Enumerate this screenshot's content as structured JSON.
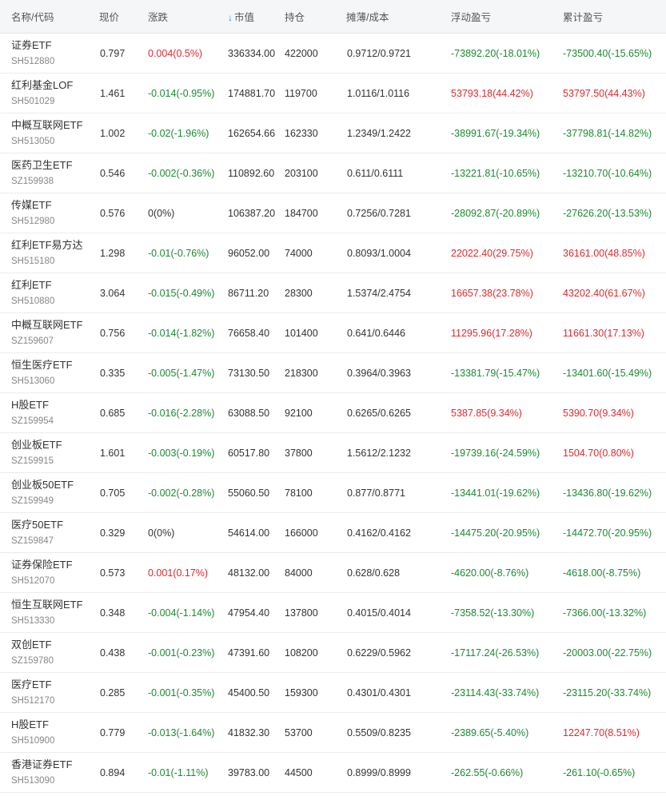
{
  "colors": {
    "up": "#e0292e",
    "down": "#1b8a32",
    "flat": "#333333",
    "sort_icon": "#1e88e5",
    "header_bg": "#f5f6f8"
  },
  "header": {
    "name": "名称/代码",
    "price": "现价",
    "change": "涨跌",
    "sort_icon": "↓",
    "market_value": "市值",
    "position": "持仓",
    "cost": "摊薄/成本",
    "floating_pnl": "浮动盈亏",
    "total_pnl": "累计盈亏"
  },
  "rows": [
    {
      "name": "证券ETF",
      "code": "SH512880",
      "price": "0.797",
      "change": "0.004(0.5%)",
      "change_dir": "up",
      "market_value": "336334.00",
      "position": "422000",
      "cost": "0.9712/0.9721",
      "floating_pnl": "-73892.20(-18.01%)",
      "floating_dir": "down",
      "total_pnl": "-73500.40(-15.65%)",
      "total_dir": "down"
    },
    {
      "name": "红利基金LOF",
      "code": "SH501029",
      "price": "1.461",
      "change": "-0.014(-0.95%)",
      "change_dir": "down",
      "market_value": "174881.70",
      "position": "119700",
      "cost": "1.0116/1.0116",
      "floating_pnl": "53793.18(44.42%)",
      "floating_dir": "up",
      "total_pnl": "53797.50(44.43%)",
      "total_dir": "up"
    },
    {
      "name": "中概互联网ETF",
      "code": "SH513050",
      "price": "1.002",
      "change": "-0.02(-1.96%)",
      "change_dir": "down",
      "market_value": "162654.66",
      "position": "162330",
      "cost": "1.2349/1.2422",
      "floating_pnl": "-38991.67(-19.34%)",
      "floating_dir": "down",
      "total_pnl": "-37798.81(-14.82%)",
      "total_dir": "down"
    },
    {
      "name": "医药卫生ETF",
      "code": "SZ159938",
      "price": "0.546",
      "change": "-0.002(-0.36%)",
      "change_dir": "down",
      "market_value": "110892.60",
      "position": "203100",
      "cost": "0.611/0.6111",
      "floating_pnl": "-13221.81(-10.65%)",
      "floating_dir": "down",
      "total_pnl": "-13210.70(-10.64%)",
      "total_dir": "down"
    },
    {
      "name": "传媒ETF",
      "code": "SH512980",
      "price": "0.576",
      "change": "0(0%)",
      "change_dir": "flat",
      "market_value": "106387.20",
      "position": "184700",
      "cost": "0.7256/0.7281",
      "floating_pnl": "-28092.87(-20.89%)",
      "floating_dir": "down",
      "total_pnl": "-27626.20(-13.53%)",
      "total_dir": "down"
    },
    {
      "name": "红利ETF易方达",
      "code": "SH515180",
      "price": "1.298",
      "change": "-0.01(-0.76%)",
      "change_dir": "down",
      "market_value": "96052.00",
      "position": "74000",
      "cost": "0.8093/1.0004",
      "floating_pnl": "22022.40(29.75%)",
      "floating_dir": "up",
      "total_pnl": "36161.00(48.85%)",
      "total_dir": "up"
    },
    {
      "name": "红利ETF",
      "code": "SH510880",
      "price": "3.064",
      "change": "-0.015(-0.49%)",
      "change_dir": "down",
      "market_value": "86711.20",
      "position": "28300",
      "cost": "1.5374/2.4754",
      "floating_pnl": "16657.38(23.78%)",
      "floating_dir": "up",
      "total_pnl": "43202.40(61.67%)",
      "total_dir": "up"
    },
    {
      "name": "中概互联网ETF",
      "code": "SZ159607",
      "price": "0.756",
      "change": "-0.014(-1.82%)",
      "change_dir": "down",
      "market_value": "76658.40",
      "position": "101400",
      "cost": "0.641/0.6446",
      "floating_pnl": "11295.96(17.28%)",
      "floating_dir": "up",
      "total_pnl": "11661.30(17.13%)",
      "total_dir": "up"
    },
    {
      "name": "恒生医疗ETF",
      "code": "SH513060",
      "price": "0.335",
      "change": "-0.005(-1.47%)",
      "change_dir": "down",
      "market_value": "73130.50",
      "position": "218300",
      "cost": "0.3964/0.3963",
      "floating_pnl": "-13381.79(-15.47%)",
      "floating_dir": "down",
      "total_pnl": "-13401.60(-15.49%)",
      "total_dir": "down"
    },
    {
      "name": "H股ETF",
      "code": "SZ159954",
      "price": "0.685",
      "change": "-0.016(-2.28%)",
      "change_dir": "down",
      "market_value": "63088.50",
      "position": "92100",
      "cost": "0.6265/0.6265",
      "floating_pnl": "5387.85(9.34%)",
      "floating_dir": "up",
      "total_pnl": "5390.70(9.34%)",
      "total_dir": "up"
    },
    {
      "name": "创业板ETF",
      "code": "SZ159915",
      "price": "1.601",
      "change": "-0.003(-0.19%)",
      "change_dir": "down",
      "market_value": "60517.80",
      "position": "37800",
      "cost": "1.5612/2.1232",
      "floating_pnl": "-19739.16(-24.59%)",
      "floating_dir": "down",
      "total_pnl": "1504.70(0.80%)",
      "total_dir": "up"
    },
    {
      "name": "创业板50ETF",
      "code": "SZ159949",
      "price": "0.705",
      "change": "-0.002(-0.28%)",
      "change_dir": "down",
      "market_value": "55060.50",
      "position": "78100",
      "cost": "0.877/0.8771",
      "floating_pnl": "-13441.01(-19.62%)",
      "floating_dir": "down",
      "total_pnl": "-13436.80(-19.62%)",
      "total_dir": "down"
    },
    {
      "name": "医疗50ETF",
      "code": "SZ159847",
      "price": "0.329",
      "change": "0(0%)",
      "change_dir": "flat",
      "market_value": "54614.00",
      "position": "166000",
      "cost": "0.4162/0.4162",
      "floating_pnl": "-14475.20(-20.95%)",
      "floating_dir": "down",
      "total_pnl": "-14472.70(-20.95%)",
      "total_dir": "down"
    },
    {
      "name": "证券保险ETF",
      "code": "SH512070",
      "price": "0.573",
      "change": "0.001(0.17%)",
      "change_dir": "up",
      "market_value": "48132.00",
      "position": "84000",
      "cost": "0.628/0.628",
      "floating_pnl": "-4620.00(-8.76%)",
      "floating_dir": "down",
      "total_pnl": "-4618.00(-8.75%)",
      "total_dir": "down"
    },
    {
      "name": "恒生互联网ETF",
      "code": "SH513330",
      "price": "0.348",
      "change": "-0.004(-1.14%)",
      "change_dir": "down",
      "market_value": "47954.40",
      "position": "137800",
      "cost": "0.4015/0.4014",
      "floating_pnl": "-7358.52(-13.30%)",
      "floating_dir": "down",
      "total_pnl": "-7366.00(-13.32%)",
      "total_dir": "down"
    },
    {
      "name": "双创ETF",
      "code": "SZ159780",
      "price": "0.438",
      "change": "-0.001(-0.23%)",
      "change_dir": "down",
      "market_value": "47391.60",
      "position": "108200",
      "cost": "0.6229/0.5962",
      "floating_pnl": "-17117.24(-26.53%)",
      "floating_dir": "down",
      "total_pnl": "-20003.00(-22.75%)",
      "total_dir": "down"
    },
    {
      "name": "医疗ETF",
      "code": "SH512170",
      "price": "0.285",
      "change": "-0.001(-0.35%)",
      "change_dir": "down",
      "market_value": "45400.50",
      "position": "159300",
      "cost": "0.4301/0.4301",
      "floating_pnl": "-23114.43(-33.74%)",
      "floating_dir": "down",
      "total_pnl": "-23115.20(-33.74%)",
      "total_dir": "down"
    },
    {
      "name": "H股ETF",
      "code": "SH510900",
      "price": "0.779",
      "change": "-0.013(-1.64%)",
      "change_dir": "down",
      "market_value": "41832.30",
      "position": "53700",
      "cost": "0.5509/0.8235",
      "floating_pnl": "-2389.65(-5.40%)",
      "floating_dir": "down",
      "total_pnl": "12247.70(8.51%)",
      "total_dir": "up"
    },
    {
      "name": "香港证券ETF",
      "code": "SH513090",
      "price": "0.894",
      "change": "-0.01(-1.11%)",
      "change_dir": "down",
      "market_value": "39783.00",
      "position": "44500",
      "cost": "0.8999/0.8999",
      "floating_pnl": "-262.55(-0.66%)",
      "floating_dir": "down",
      "total_pnl": "-261.10(-0.65%)",
      "total_dir": "down"
    }
  ]
}
